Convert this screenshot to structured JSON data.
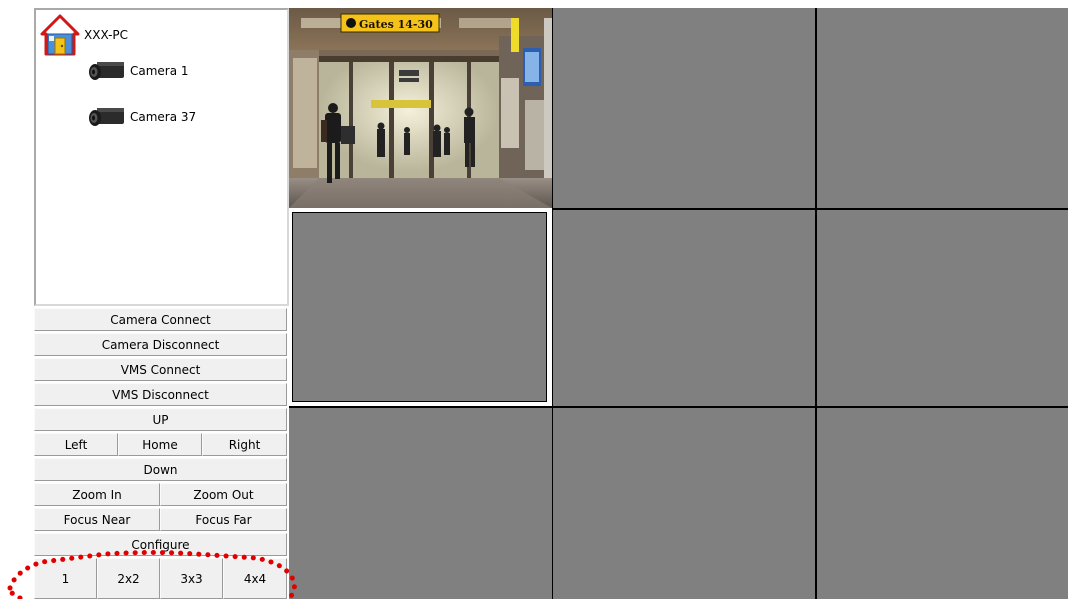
{
  "tree": {
    "root_label": "XXX-PC",
    "cameras": [
      "Camera 1",
      "Camera 37"
    ]
  },
  "controls": {
    "camera_connect": "Camera Connect",
    "camera_disconnect": "Camera Disconnect",
    "vms_connect": "VMS Connect",
    "vms_disconnect": "VMS Disconnect",
    "up": "UP",
    "left": "Left",
    "home": "Home",
    "right": "Right",
    "down": "Down",
    "zoom_in": "Zoom In",
    "zoom_out": "Zoom Out",
    "focus_near": "Focus Near",
    "focus_far": "Focus Far",
    "configure": "Configure"
  },
  "layouts": [
    "1",
    "2x2",
    "3x3",
    "4x4"
  ],
  "video": {
    "sign_text": "Gates 14-30"
  },
  "colors": {
    "empty_tile": "#808080",
    "annotation": "#e00000"
  }
}
